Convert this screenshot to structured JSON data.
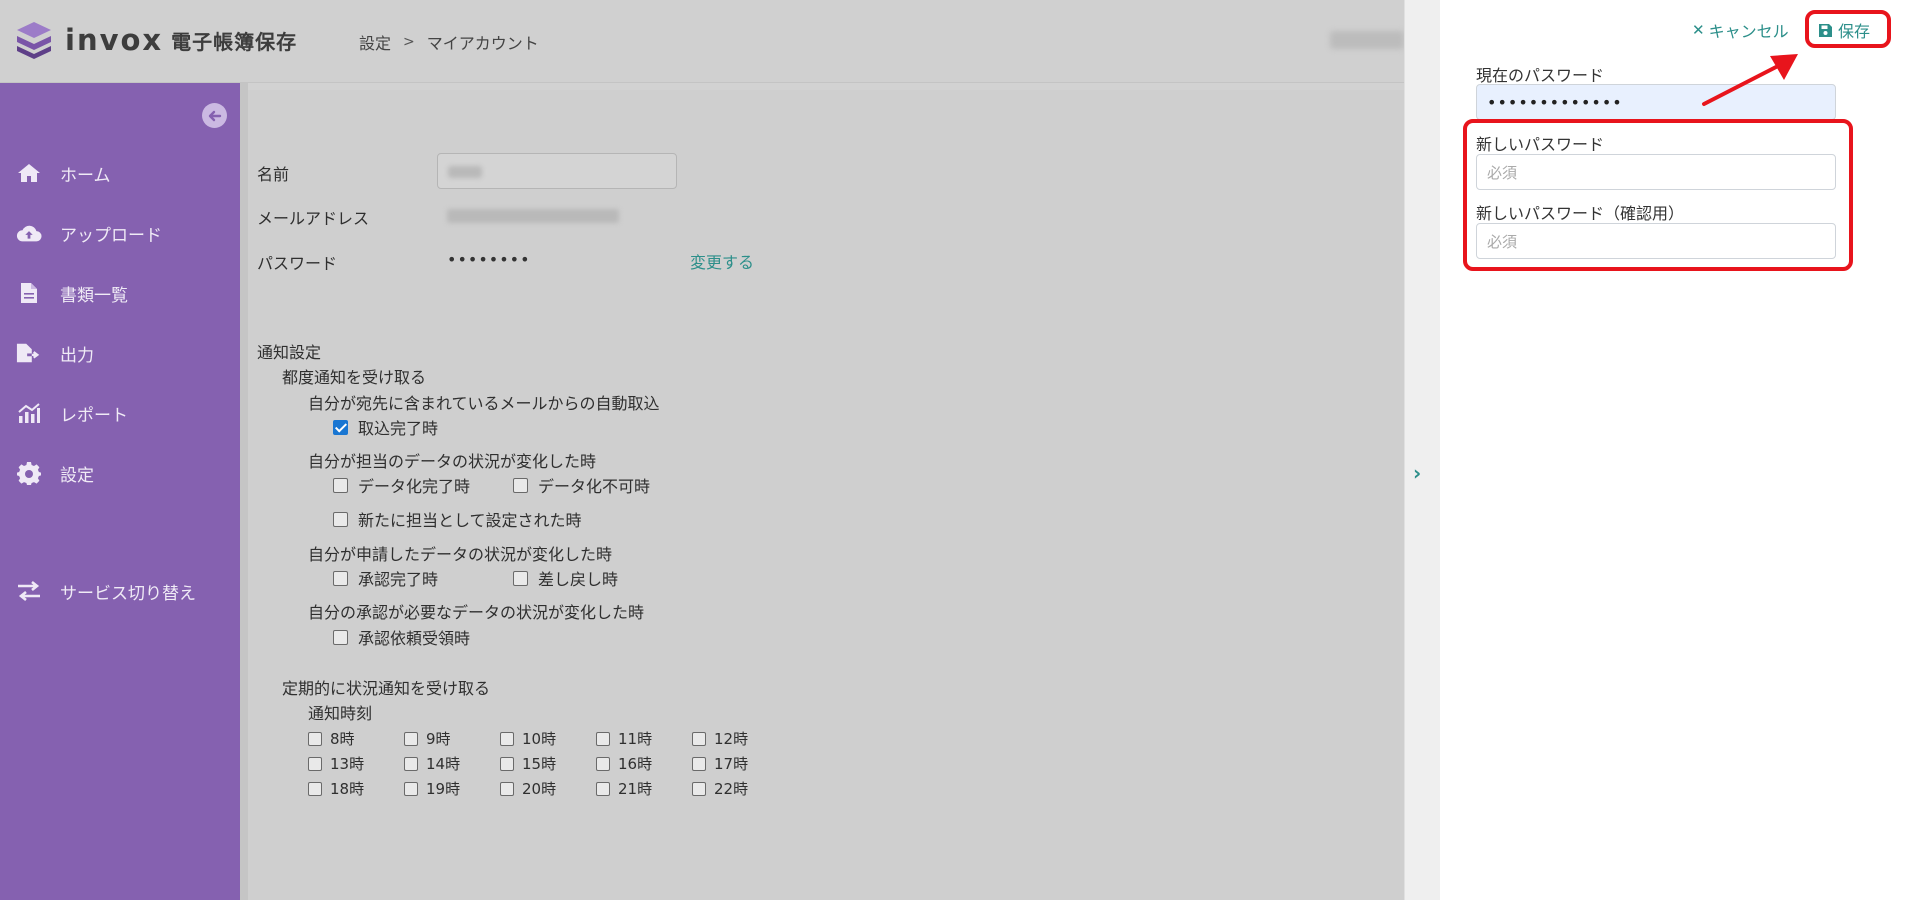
{
  "app": {
    "brand_main": "invox",
    "brand_sub": "電子帳簿保存",
    "brand_color": "#8561b0",
    "accent_color": "#2c8f8a"
  },
  "breadcrumb": {
    "items": [
      "設定",
      "マイアカウント"
    ],
    "separator": ">"
  },
  "sidebar": {
    "items": [
      {
        "label": "ホーム",
        "icon": "home-icon"
      },
      {
        "label": "アップロード",
        "icon": "cloud-upload-icon"
      },
      {
        "label": "書類一覧",
        "icon": "document-icon"
      },
      {
        "label": "出力",
        "icon": "file-export-icon"
      },
      {
        "label": "レポート",
        "icon": "chart-icon"
      },
      {
        "label": "設定",
        "icon": "gear-icon"
      },
      {
        "label": "サービス切り替え",
        "icon": "switch-icon"
      }
    ]
  },
  "account": {
    "name_label": "名前",
    "email_label": "メールアドレス",
    "password_label": "パスワード",
    "password_value": "••••••••",
    "change_link": "変更する"
  },
  "notifications": {
    "title": "通知設定",
    "each_title": "都度通知を受け取る",
    "groups": [
      {
        "title": "自分が宛先に含まれているメールからの自動取込",
        "options": [
          {
            "label": "取込完了時",
            "checked": true
          }
        ]
      },
      {
        "title": "自分が担当のデータの状況が変化した時",
        "options": [
          {
            "label": "データ化完了時",
            "checked": false
          },
          {
            "label": "データ化不可時",
            "checked": false
          },
          {
            "label": "新たに担当として設定された時",
            "checked": false
          }
        ]
      },
      {
        "title": "自分が申請したデータの状況が変化した時",
        "options": [
          {
            "label": "承認完了時",
            "checked": false
          },
          {
            "label": "差し戻し時",
            "checked": false
          }
        ]
      },
      {
        "title": "自分の承認が必要なデータの状況が変化した時",
        "options": [
          {
            "label": "承認依頼受領時",
            "checked": false
          }
        ]
      }
    ],
    "periodic_title": "定期的に状況通知を受け取る",
    "time_label": "通知時刻",
    "hours": [
      "8時",
      "9時",
      "10時",
      "11時",
      "12時",
      "13時",
      "14時",
      "15時",
      "16時",
      "17時",
      "18時",
      "19時",
      "20時",
      "21時",
      "22時"
    ]
  },
  "password_panel": {
    "cancel_label": "キャンセル",
    "save_label": "保存",
    "current_label": "現在のパスワード",
    "current_value": "•••••••••••••",
    "new_label": "新しいパスワード",
    "new_placeholder": "必須",
    "confirm_label": "新しいパスワード（確認用）",
    "confirm_placeholder": "必須"
  },
  "annotation_color": "#e8141c"
}
